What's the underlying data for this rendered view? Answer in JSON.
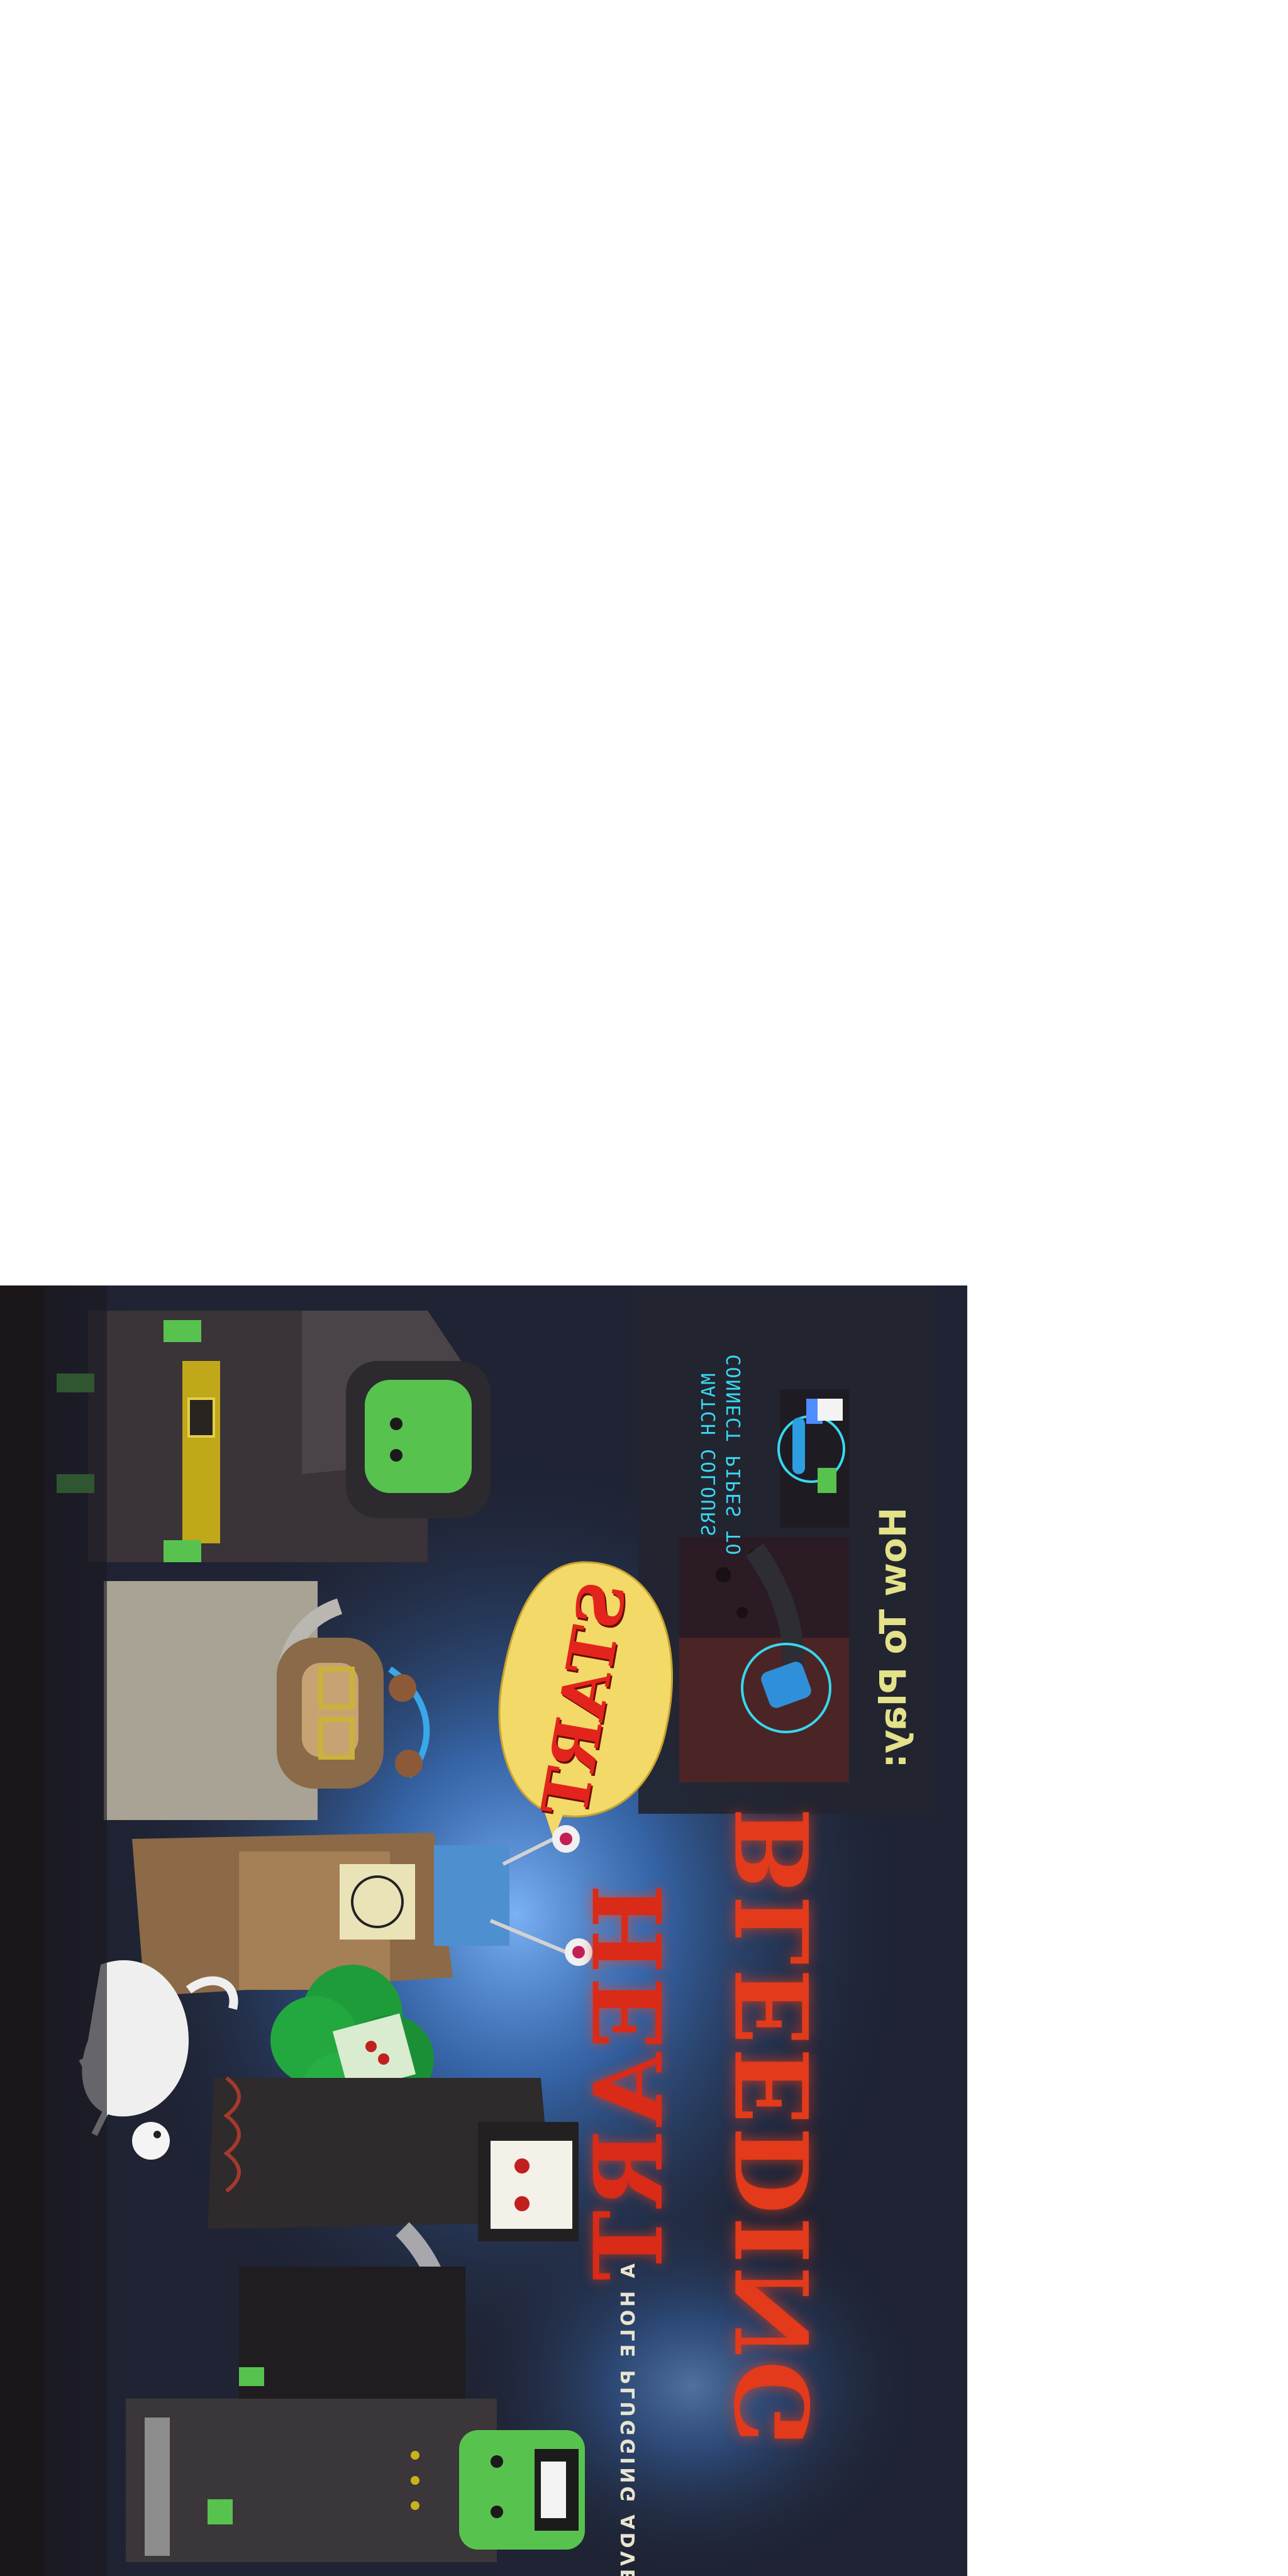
{
  "game": {
    "title_line1": "HEART",
    "title_line2": "BLEEDING",
    "tagline": "A HOLE PLUGGING ADVENTURE",
    "start_label": "START",
    "how_to_play": {
      "heading": "How To Play:",
      "instructions": [
        "MATCH COLOURS",
        "CONNECT PIPES TO"
      ]
    },
    "characters": [
      "frankenstein-monster-icon",
      "vampire-icon",
      "unicorn-icon",
      "broccoli-icon",
      "scarecrow-icon",
      "mad-scientist-icon",
      "witch-icon"
    ]
  },
  "colors": {
    "background": "#1e2130",
    "glow": "#3f7fd6",
    "title_red": "#d92b17",
    "start_bubble": "#f3d967",
    "start_text": "#e3241c",
    "instruction_cyan": "#39d7f0",
    "heading_yellow": "#e3e18a",
    "monster_green": "#58c24f",
    "panel": "#232530"
  }
}
